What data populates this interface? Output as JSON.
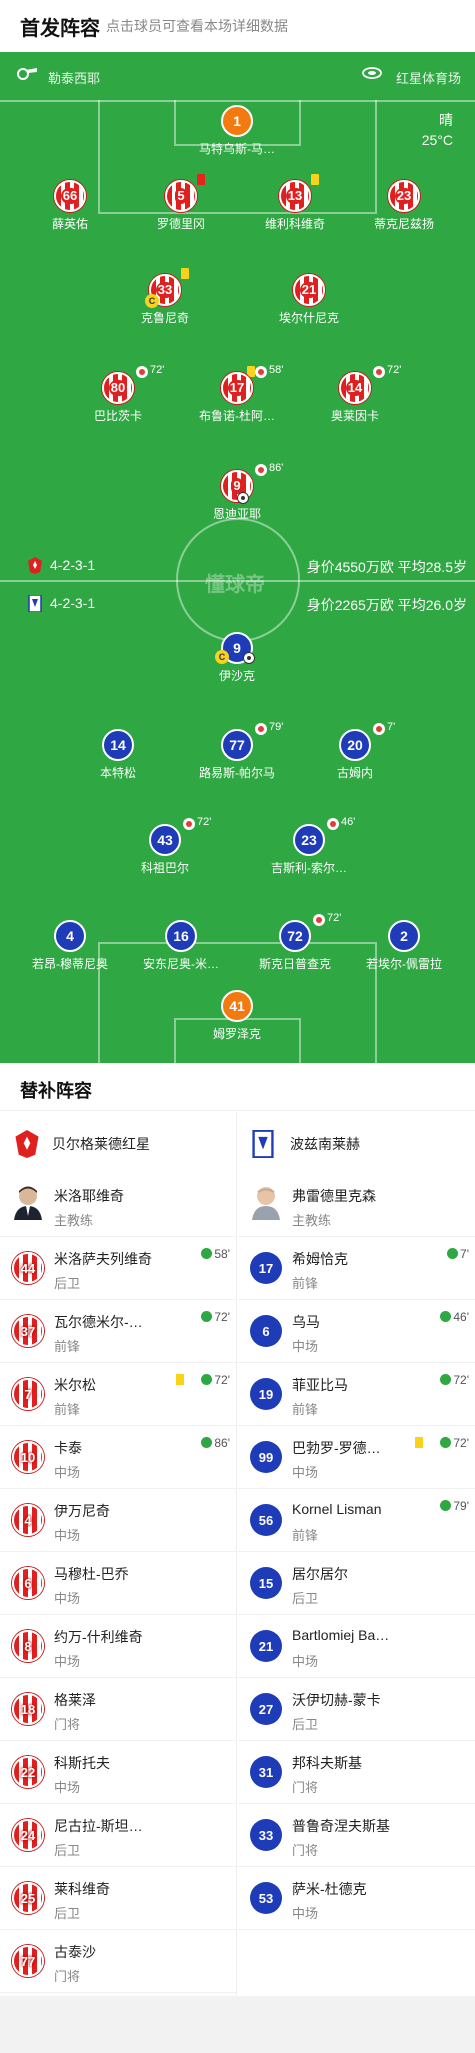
{
  "header": {
    "title": "首发阵容",
    "subtitle": "点击球员可查看本场详细数据"
  },
  "match": {
    "home_team": "勒泰西耶",
    "venue": "红星体育场",
    "weather": "晴",
    "temperature": "25°C"
  },
  "home_team": {
    "formation": "4-2-3-1",
    "value": "身价4550万欧 平均28.5岁",
    "players": [
      {
        "num": "1",
        "name": "马特乌斯-马…"
      },
      {
        "num": "66",
        "name": "薛英佑"
      },
      {
        "num": "5",
        "name": "罗德里冈"
      },
      {
        "num": "13",
        "name": "维利科维奇"
      },
      {
        "num": "23",
        "name": "蒂克尼兹扬"
      },
      {
        "num": "33",
        "name": "克鲁尼奇"
      },
      {
        "num": "21",
        "name": "埃尔什尼克"
      },
      {
        "num": "80",
        "name": "巴比茨卡",
        "sub": "72'"
      },
      {
        "num": "17",
        "name": "布鲁诺-杜阿…",
        "sub": "58'"
      },
      {
        "num": "14",
        "name": "奥莱因卡",
        "sub": "72'"
      },
      {
        "num": "9",
        "name": "恩迪亚耶",
        "sub": "86'"
      }
    ]
  },
  "away_team": {
    "formation": "4-2-3-1",
    "value": "身价2265万欧 平均26.0岁",
    "players": [
      {
        "num": "9",
        "name": "伊沙克"
      },
      {
        "num": "14",
        "name": "本特松"
      },
      {
        "num": "77",
        "name": "路易斯-帕尔马",
        "sub": "79'"
      },
      {
        "num": "20",
        "name": "古姆内",
        "sub": "7'"
      },
      {
        "num": "43",
        "name": "科祖巴尔",
        "sub": "72'"
      },
      {
        "num": "23",
        "name": "吉斯利-索尔…",
        "sub": "46'"
      },
      {
        "num": "4",
        "name": "若昂-穆蒂尼奥"
      },
      {
        "num": "16",
        "name": "安东尼奥-米…"
      },
      {
        "num": "72",
        "name": "斯克日普查克",
        "sub": "72'"
      },
      {
        "num": "2",
        "name": "若埃尔-佩雷拉"
      },
      {
        "num": "41",
        "name": "姆罗泽克"
      }
    ]
  },
  "watermark": "懂球帝",
  "bench_title": "替补阵容",
  "bench": {
    "home": {
      "team": "贝尔格莱德红星",
      "coach": {
        "name": "米洛耶维奇",
        "role": "主教练"
      },
      "subs": [
        {
          "num": "44",
          "name": "米洛萨夫列维奇",
          "pos": "后卫",
          "in": "58'"
        },
        {
          "num": "37",
          "name": "瓦尔德米尔-…",
          "pos": "前锋",
          "in": "72'"
        },
        {
          "num": "7",
          "name": "米尔松",
          "pos": "前锋",
          "in": "72'"
        },
        {
          "num": "10",
          "name": "卡泰",
          "pos": "中场",
          "in": "86'"
        },
        {
          "num": "4",
          "name": "伊万尼奇",
          "pos": "中场"
        },
        {
          "num": "6",
          "name": "马穆杜-巴乔",
          "pos": "中场"
        },
        {
          "num": "8",
          "name": "约万-什利维奇",
          "pos": "中场"
        },
        {
          "num": "18",
          "name": "格莱泽",
          "pos": "门将"
        },
        {
          "num": "22",
          "name": "科斯托夫",
          "pos": "中场"
        },
        {
          "num": "24",
          "name": "尼古拉-斯坦…",
          "pos": "后卫"
        },
        {
          "num": "25",
          "name": "莱科维奇",
          "pos": "后卫"
        },
        {
          "num": "77",
          "name": "古泰沙",
          "pos": "门将"
        }
      ]
    },
    "away": {
      "team": "波兹南莱赫",
      "coach": {
        "name": "弗雷德里克森",
        "role": "主教练"
      },
      "subs": [
        {
          "num": "17",
          "name": "希姆恰克",
          "pos": "前锋",
          "in": "7'"
        },
        {
          "num": "6",
          "name": "乌马",
          "pos": "中场",
          "in": "46'"
        },
        {
          "num": "19",
          "name": "菲亚比马",
          "pos": "前锋",
          "in": "72'"
        },
        {
          "num": "99",
          "name": "巴勃罗-罗德…",
          "pos": "中场",
          "in": "72'"
        },
        {
          "num": "56",
          "name": "Kornel Lisman",
          "pos": "前锋",
          "in": "79'"
        },
        {
          "num": "15",
          "name": "居尔居尔",
          "pos": "后卫"
        },
        {
          "num": "21",
          "name": "Bartlomiej Ba…",
          "pos": "中场"
        },
        {
          "num": "27",
          "name": "沃伊切赫-蒙卡",
          "pos": "后卫"
        },
        {
          "num": "31",
          "name": "邦科夫斯基",
          "pos": "门将"
        },
        {
          "num": "33",
          "name": "普鲁奇涅夫斯基",
          "pos": "门将"
        },
        {
          "num": "53",
          "name": "萨米-杜德克",
          "pos": "中场"
        }
      ]
    }
  },
  "colors": {
    "pitch": "#2fa742",
    "home": "#e0201f",
    "away": "#1f3cb8",
    "keeper_home": "#f27a10"
  }
}
